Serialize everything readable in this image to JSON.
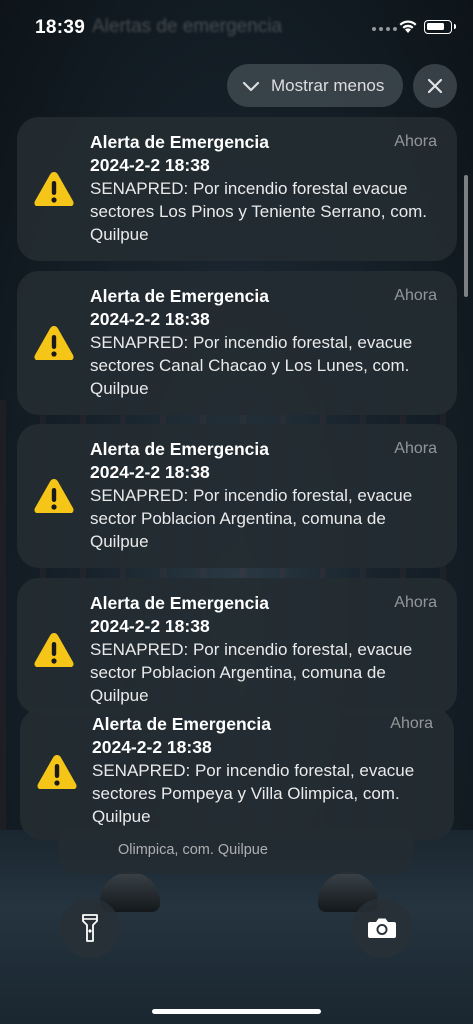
{
  "status_bar": {
    "time": "18:39",
    "background_title": "Alertas de emergencia"
  },
  "controls": {
    "show_less_label": "Mostrar menos",
    "show_less_icon": "chevron-down-icon",
    "close_icon": "close-icon"
  },
  "notifications": [
    {
      "title": "Alerta de Emergencia",
      "subtitle": "2024-2-2 18:38",
      "body": "SENAPRED: Por incendio forestal evacue sectores Los Pinos y Teniente Serrano, com. Quilpue",
      "time": "Ahora",
      "icon": "warning-icon"
    },
    {
      "title": "Alerta de Emergencia",
      "subtitle": "2024-2-2 18:38",
      "body": "SENAPRED: Por incendio forestal, evacue sectores Canal Chacao y Los Lunes, com. Quilpue",
      "time": "Ahora",
      "icon": "warning-icon"
    },
    {
      "title": "Alerta de Emergencia",
      "subtitle": "2024-2-2 18:38",
      "body": "SENAPRED: Por incendio forestal, evacue sector Poblacion Argentina, comuna de Quilpue",
      "time": "Ahora",
      "icon": "warning-icon"
    },
    {
      "title": "Alerta de Emergencia",
      "subtitle": "2024-2-2 18:38",
      "body": "SENAPRED: Por incendio forestal, evacue sector Poblacion Argentina, comuna de Quilpue",
      "time": "Ahora",
      "icon": "warning-icon"
    },
    {
      "title": "Alerta de Emergencia",
      "subtitle": "2024-2-2 18:38",
      "body": "SENAPRED: Por incendio forestal, evacue sectores Pompeya y Villa Olimpica, com. Quilpue",
      "time": "Ahora",
      "icon": "warning-icon"
    }
  ],
  "stacked_notification_text": "Olimpica, com. Quilpue",
  "lock_screen": {
    "left_button_icon": "flashlight-icon",
    "right_button_icon": "camera-icon"
  },
  "colors": {
    "warning_yellow": "#F5C518",
    "card_background": "#242C32"
  }
}
